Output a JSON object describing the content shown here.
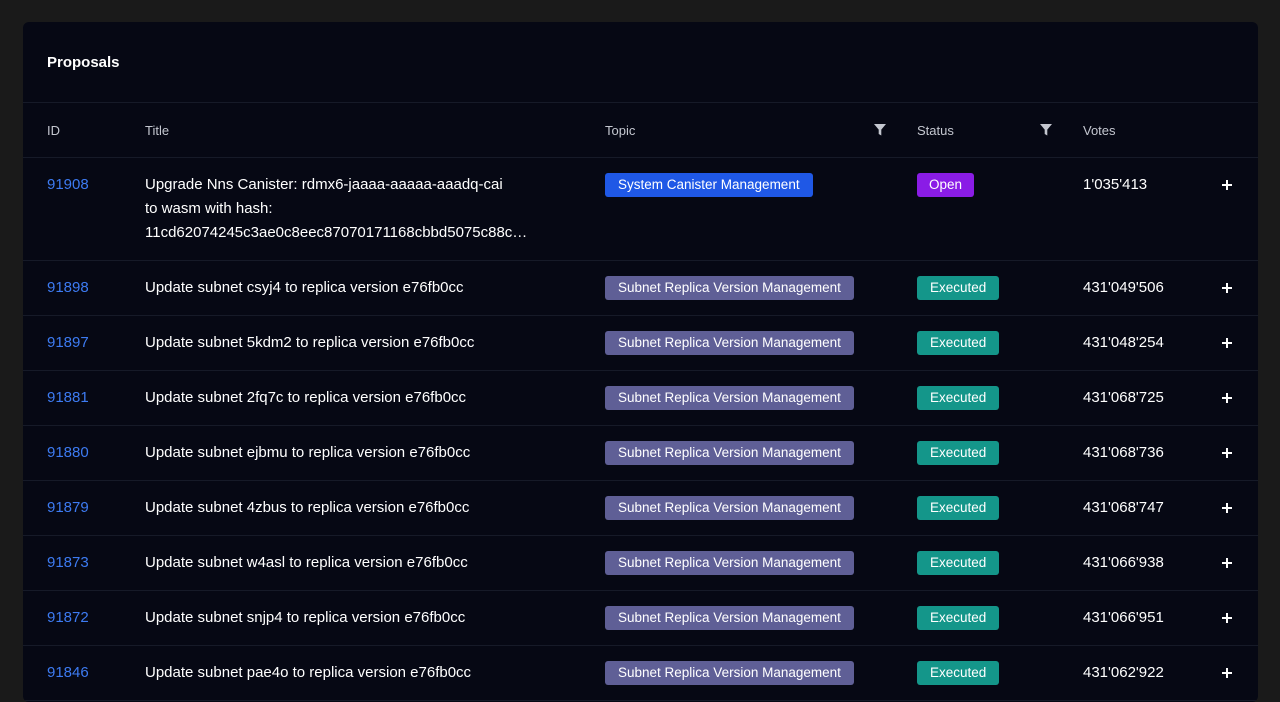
{
  "card": {
    "title": "Proposals"
  },
  "table": {
    "headers": {
      "id": "ID",
      "title": "Title",
      "topic": "Topic",
      "status": "Status",
      "votes": "Votes"
    },
    "rows": [
      {
        "id": "91908",
        "title": "Upgrade Nns Canister: rdmx6-jaaaa-aaaaa-aaadq-cai to wasm with hash: 11cd62074245c3ae0c8eec87070171168cbbd5075c88c…",
        "title_lines": [
          "Upgrade Nns Canister: rdmx6-jaaaa-aaaaa-aaadq-cai",
          "to wasm with hash:",
          "11cd62074245c3ae0c8eec87070171168cbbd5075c88c…"
        ],
        "topic": "System Canister Management",
        "status": "Open",
        "votes": "1'035'413"
      },
      {
        "id": "91898",
        "title": "Update subnet csyj4 to replica version e76fb0cc",
        "topic": "Subnet Replica Version Management",
        "status": "Executed",
        "votes": "431'049'506"
      },
      {
        "id": "91897",
        "title": "Update subnet 5kdm2 to replica version e76fb0cc",
        "topic": "Subnet Replica Version Management",
        "status": "Executed",
        "votes": "431'048'254"
      },
      {
        "id": "91881",
        "title": "Update subnet 2fq7c to replica version e76fb0cc",
        "topic": "Subnet Replica Version Management",
        "status": "Executed",
        "votes": "431'068'725"
      },
      {
        "id": "91880",
        "title": "Update subnet ejbmu to replica version e76fb0cc",
        "topic": "Subnet Replica Version Management",
        "status": "Executed",
        "votes": "431'068'736"
      },
      {
        "id": "91879",
        "title": "Update subnet 4zbus to replica version e76fb0cc",
        "topic": "Subnet Replica Version Management",
        "status": "Executed",
        "votes": "431'068'747"
      },
      {
        "id": "91873",
        "title": "Update subnet w4asl to replica version e76fb0cc",
        "topic": "Subnet Replica Version Management",
        "status": "Executed",
        "votes": "431'066'938"
      },
      {
        "id": "91872",
        "title": "Update subnet snjp4 to replica version e76fb0cc",
        "topic": "Subnet Replica Version Management",
        "status": "Executed",
        "votes": "431'066'951"
      },
      {
        "id": "91846",
        "title": "Update subnet pae4o to replica version e76fb0cc",
        "topic": "Subnet Replica Version Management",
        "status": "Executed",
        "votes": "431'062'922"
      }
    ]
  },
  "icons": {
    "filter": "filter-icon",
    "expand": "plus-icon"
  },
  "colors": {
    "background": "#1a1a1a",
    "card": "#060814",
    "link": "#3d7bf2",
    "badge_system": "#1f58e6",
    "badge_subnet": "#5f5f96",
    "badge_open": "#8a1ce6",
    "badge_executed": "#14968a"
  }
}
